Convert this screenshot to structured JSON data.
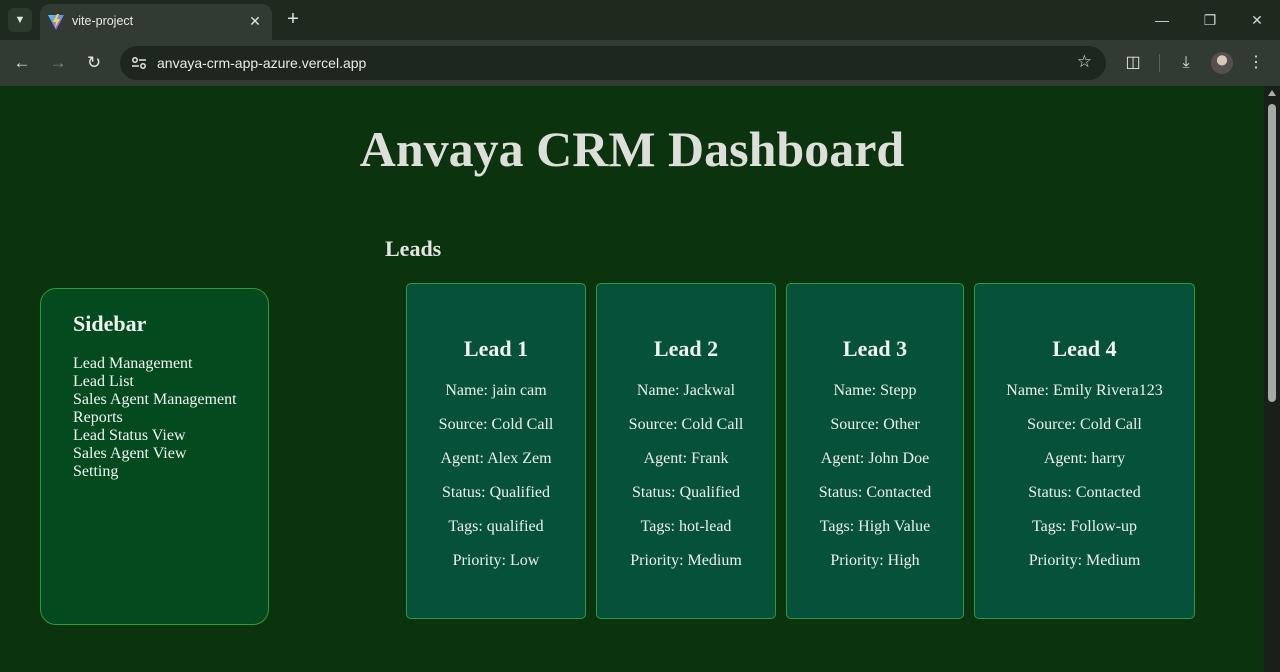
{
  "browser": {
    "tab_title": "vite-project",
    "url": "anvaya-crm-app-azure.vercel.app"
  },
  "icons": {
    "tab_search": "chevron-down-icon",
    "favicon": "vite-logo-icon",
    "close": "close-icon",
    "new_tab": "plus-icon",
    "back": "arrow-left-icon",
    "forward": "arrow-right-icon",
    "reload": "reload-icon",
    "site_info": "tune-icon",
    "bookmark": "star-icon",
    "extensions": "puzzle-icon",
    "download": "download-icon",
    "menu": "kebab-menu-icon"
  },
  "colors": {
    "page_bg": "#0b330e",
    "card_bg": "#06513a",
    "sidebar_bg": "#034a1f",
    "border": "#2e9a3a"
  },
  "page": {
    "title": "Anvaya CRM Dashboard"
  },
  "sidebar": {
    "title": "Sidebar",
    "items": [
      {
        "label": "Lead Management"
      },
      {
        "label": "Lead List"
      },
      {
        "label": "Sales Agent Management"
      },
      {
        "label": "Reports"
      },
      {
        "label": "Lead Status View"
      },
      {
        "label": "Sales Agent View"
      },
      {
        "label": "Setting"
      }
    ]
  },
  "leads": {
    "heading": "Leads",
    "cards": [
      {
        "title": "Lead 1",
        "name": "Name: jain cam",
        "source": "Source: Cold Call",
        "agent": "Agent: Alex Zem",
        "status": "Status: Qualified",
        "tags": "Tags: qualified",
        "priority": "Priority: Low"
      },
      {
        "title": "Lead 2",
        "name": "Name: Jackwal",
        "source": "Source: Cold Call",
        "agent": "Agent: Frank",
        "status": "Status: Qualified",
        "tags": "Tags: hot-lead",
        "priority": "Priority: Medium"
      },
      {
        "title": "Lead 3",
        "name": "Name: Stepp",
        "source": "Source: Other",
        "agent": "Agent: John Doe",
        "status": "Status: Contacted",
        "tags": "Tags: High Value",
        "priority": "Priority: High"
      },
      {
        "title": "Lead 4",
        "name": "Name: Emily Rivera123",
        "source": "Source: Cold Call",
        "agent": "Agent: harry",
        "status": "Status: Contacted",
        "tags": "Tags: Follow-up",
        "priority": "Priority: Medium"
      }
    ]
  }
}
